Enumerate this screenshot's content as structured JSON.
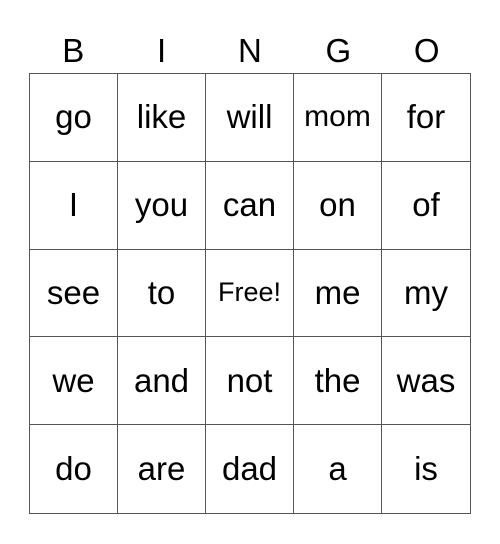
{
  "header": [
    "B",
    "I",
    "N",
    "G",
    "O"
  ],
  "grid": [
    [
      "go",
      "like",
      "will",
      "mom",
      "for"
    ],
    [
      "I",
      "you",
      "can",
      "on",
      "of"
    ],
    [
      "see",
      "to",
      "Free!",
      "me",
      "my"
    ],
    [
      "we",
      "and",
      "not",
      "the",
      "was"
    ],
    [
      "do",
      "are",
      "dad",
      "a",
      "is"
    ]
  ]
}
